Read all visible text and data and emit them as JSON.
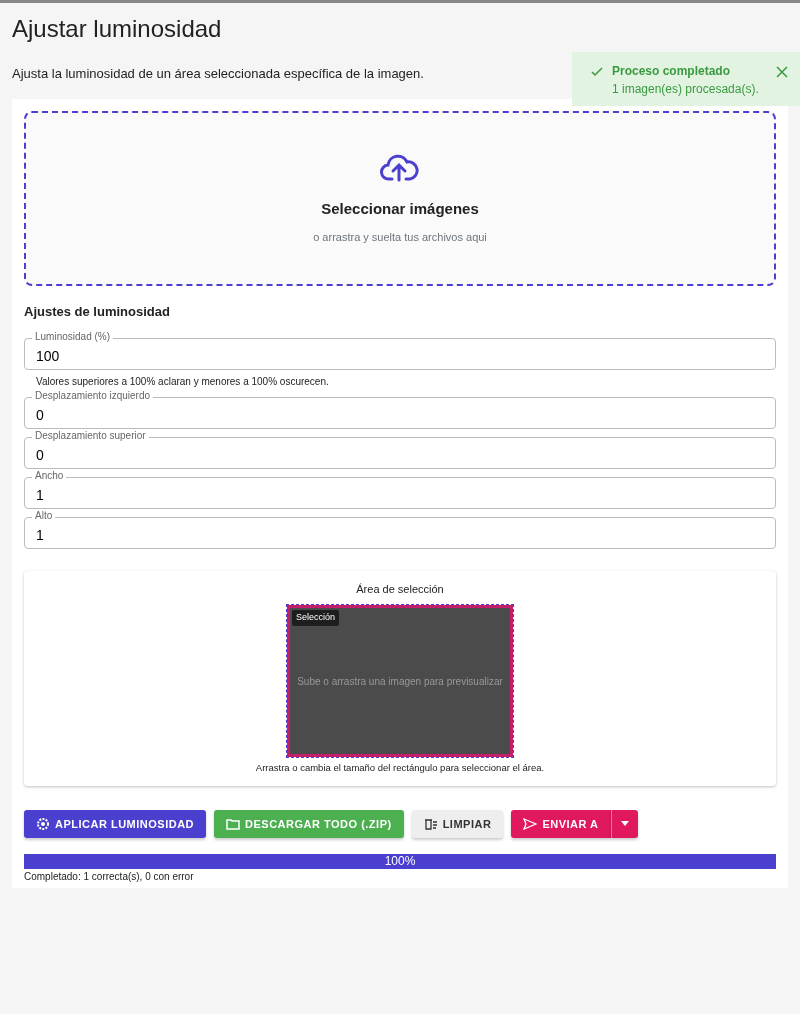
{
  "title": "Ajustar luminosidad",
  "description": "Ajusta la luminosidad de un área seleccionada específica de la imagen.",
  "toast": {
    "title": "Proceso completado",
    "message": "1 imagen(es) procesada(s)."
  },
  "dropzone": {
    "title": "Seleccionar imágenes",
    "hint": "o arrastra y suelta tus archivos aqui"
  },
  "settings": {
    "heading": "Ajustes de luminosidad",
    "fields": [
      {
        "label": "Luminosidad (%)",
        "value": "100",
        "help": "Valores superiores a 100% aclaran y menores a 100% oscurecen."
      },
      {
        "label": "Desplazamiento izquierdo",
        "value": "0"
      },
      {
        "label": "Desplazamiento superior",
        "value": "0"
      },
      {
        "label": "Ancho",
        "value": "1"
      },
      {
        "label": "Alto",
        "value": "1"
      }
    ]
  },
  "selection": {
    "title": "Área de selección",
    "tag": "Selección",
    "placeholder": "Sube o arrastra una imagen para previsualizar",
    "hint": "Arrastra o cambia el tamaño del rectángulo para seleccionar el área."
  },
  "buttons": [
    {
      "kind": "apply",
      "label": "APLICAR LUMINOSIDAD"
    },
    {
      "kind": "download",
      "label": "DESCARGAR TODO (.ZIP)"
    },
    {
      "kind": "clear",
      "label": "LIMPIAR"
    },
    {
      "kind": "send",
      "label": "ENVIAR A"
    }
  ],
  "progress": {
    "level": 1,
    "label": "100%",
    "status": "Completado: 1 correcta(s), 0 con error"
  }
}
